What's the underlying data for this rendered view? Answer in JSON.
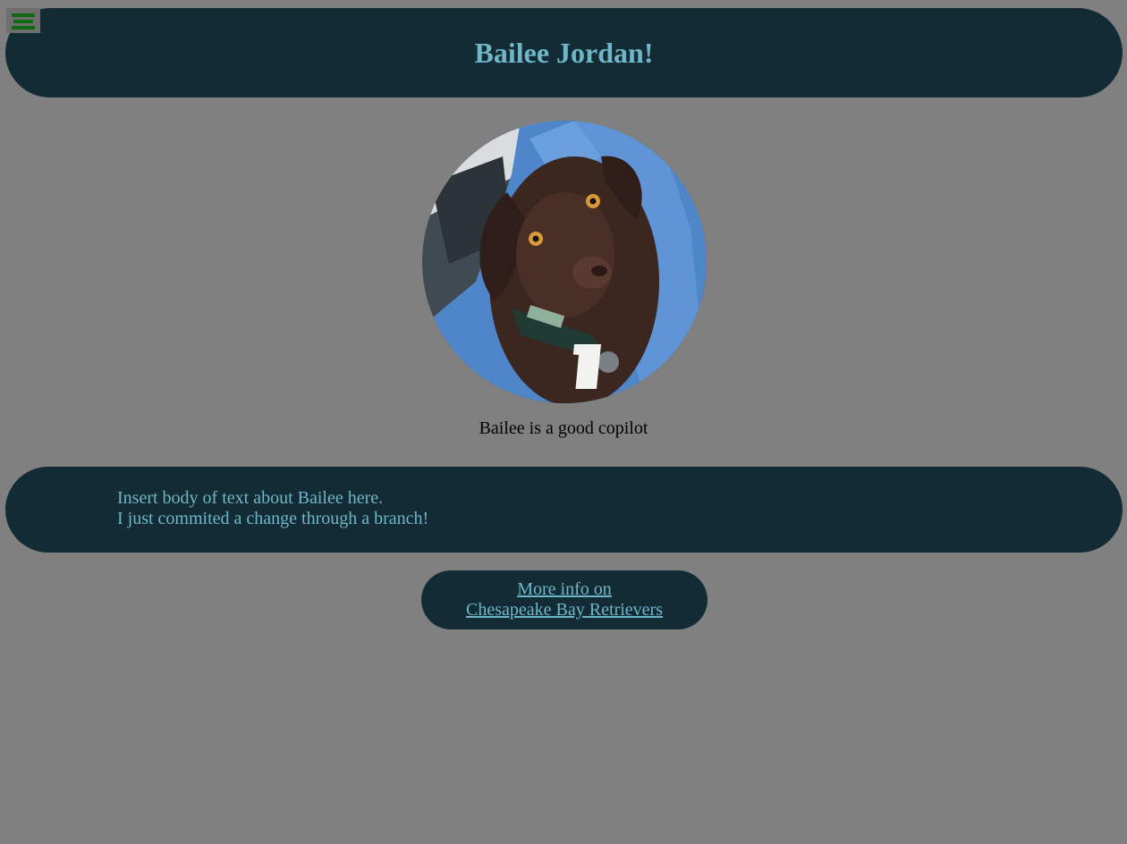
{
  "header": {
    "title": "Bailee Jordan!"
  },
  "menu": {
    "icon": "hamburger-menu-icon"
  },
  "photo": {
    "subject": "chocolate-brown-dog-on-blue-towel-in-car"
  },
  "caption": "Bailee is a good copilot",
  "body": {
    "lines": [
      "Insert body of text about Bailee here.",
      "I just commited a change through a branch!"
    ]
  },
  "link": {
    "lines": [
      "More info on",
      "Chesapeake Bay Retrievers"
    ]
  },
  "colors": {
    "page_background": "#808080",
    "panel_background": "#132b34",
    "accent_text": "#6fb6c8",
    "menu_icon": "#0f6b12"
  }
}
